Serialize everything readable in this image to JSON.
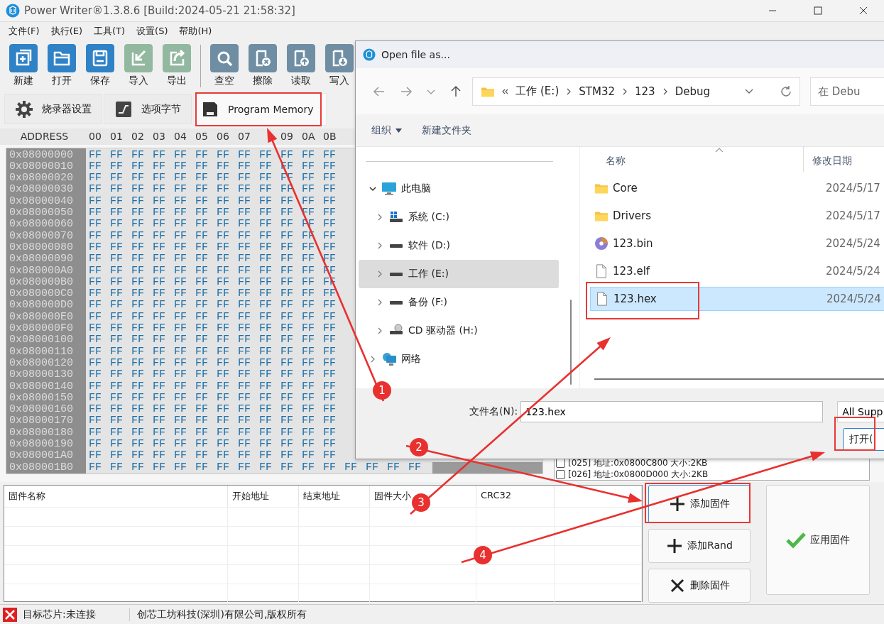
{
  "window": {
    "title": "Power Writer®1.3.8.6 [Build:2024-05-21 21:58:32]"
  },
  "menu": [
    "文件(F)",
    "执行(E)",
    "工具(T)",
    "设置(S)",
    "帮助(H)"
  ],
  "toolbar": {
    "groups": [
      {
        "buttons": [
          "新建",
          "打开",
          "保存",
          "导入",
          "导出"
        ]
      },
      {
        "buttons": [
          "查空",
          "擦除",
          "读取",
          "写入"
        ]
      }
    ]
  },
  "tabs": [
    {
      "label": "烧录器设置",
      "selected": false
    },
    {
      "label": "选项字节",
      "selected": false
    },
    {
      "label": "Program Memory",
      "selected": true
    }
  ],
  "hex_view": {
    "address_header": "ADDRESS",
    "columns": [
      "00",
      "01",
      "02",
      "03",
      "04",
      "05",
      "06",
      "07"
    ],
    "columns_after_arrow": [
      "09",
      "0A",
      "0B"
    ],
    "rows": [
      {
        "address": "0x08000000",
        "bytes": [
          "FF",
          "FF",
          "FF",
          "FF",
          "FF",
          "FF",
          "FF",
          "FF",
          "FF",
          "FF",
          "FF",
          "FF"
        ]
      },
      {
        "address": "0x08000010",
        "bytes": [
          "FF",
          "FF",
          "FF",
          "FF",
          "FF",
          "FF",
          "FF",
          "FF",
          "FF",
          "FF",
          "FF",
          "FF"
        ]
      },
      {
        "address": "0x08000020",
        "bytes": [
          "FF",
          "FF",
          "FF",
          "FF",
          "FF",
          "FF",
          "FF",
          "FF",
          "FF",
          "FF",
          "FF",
          "FF"
        ]
      },
      {
        "address": "0x08000030",
        "bytes": [
          "FF",
          "FF",
          "FF",
          "FF",
          "FF",
          "FF",
          "FF",
          "FF",
          "FF",
          "FF",
          "FF",
          "FF"
        ]
      },
      {
        "address": "0x08000040",
        "bytes": [
          "FF",
          "FF",
          "FF",
          "FF",
          "FF",
          "FF",
          "FF",
          "FF",
          "FF",
          "FF",
          "FF",
          "FF"
        ]
      },
      {
        "address": "0x08000050",
        "bytes": [
          "FF",
          "FF",
          "FF",
          "FF",
          "FF",
          "FF",
          "FF",
          "FF",
          "FF",
          "FF",
          "FF",
          "FF"
        ]
      },
      {
        "address": "0x08000060",
        "bytes": [
          "FF",
          "FF",
          "FF",
          "FF",
          "FF",
          "FF",
          "FF",
          "FF",
          "FF",
          "FF",
          "FF",
          "FF"
        ]
      },
      {
        "address": "0x08000070",
        "bytes": [
          "FF",
          "FF",
          "FF",
          "FF",
          "FF",
          "FF",
          "FF",
          "FF",
          "FF",
          "FF",
          "FF",
          "FF"
        ]
      },
      {
        "address": "0x08000080",
        "bytes": [
          "FF",
          "FF",
          "FF",
          "FF",
          "FF",
          "FF",
          "FF",
          "FF",
          "FF",
          "FF",
          "FF",
          "FF"
        ]
      },
      {
        "address": "0x08000090",
        "bytes": [
          "FF",
          "FF",
          "FF",
          "FF",
          "FF",
          "FF",
          "FF",
          "FF",
          "FF",
          "FF",
          "FF",
          "FF"
        ]
      },
      {
        "address": "0x080000A0",
        "bytes": [
          "FF",
          "FF",
          "FF",
          "FF",
          "FF",
          "FF",
          "FF",
          "FF",
          "FF",
          "FF",
          "FF",
          "FF"
        ]
      },
      {
        "address": "0x080000B0",
        "bytes": [
          "FF",
          "FF",
          "FF",
          "FF",
          "FF",
          "FF",
          "FF",
          "FF",
          "FF",
          "FF",
          "FF",
          "FF"
        ]
      },
      {
        "address": "0x080000C0",
        "bytes": [
          "FF",
          "FF",
          "FF",
          "FF",
          "FF",
          "FF",
          "FF",
          "FF",
          "FF",
          "FF",
          "FF",
          "FF"
        ]
      },
      {
        "address": "0x080000D0",
        "bytes": [
          "FF",
          "FF",
          "FF",
          "FF",
          "FF",
          "FF",
          "FF",
          "FF",
          "FF",
          "FF",
          "FF",
          "FF"
        ]
      },
      {
        "address": "0x080000E0",
        "bytes": [
          "FF",
          "FF",
          "FF",
          "FF",
          "FF",
          "FF",
          "FF",
          "FF",
          "FF",
          "FF",
          "FF",
          "FF"
        ]
      },
      {
        "address": "0x080000F0",
        "bytes": [
          "FF",
          "FF",
          "FF",
          "FF",
          "FF",
          "FF",
          "FF",
          "FF",
          "FF",
          "FF",
          "FF",
          "FF"
        ]
      },
      {
        "address": "0x08000100",
        "bytes": [
          "FF",
          "FF",
          "FF",
          "FF",
          "FF",
          "FF",
          "FF",
          "FF",
          "FF",
          "FF",
          "FF",
          "FF"
        ]
      },
      {
        "address": "0x08000110",
        "bytes": [
          "FF",
          "FF",
          "FF",
          "FF",
          "FF",
          "FF",
          "FF",
          "FF",
          "FF",
          "FF",
          "FF",
          "FF"
        ]
      },
      {
        "address": "0x08000120",
        "bytes": [
          "FF",
          "FF",
          "FF",
          "FF",
          "FF",
          "FF",
          "FF",
          "FF",
          "FF",
          "FF",
          "FF",
          "FF"
        ]
      },
      {
        "address": "0x08000130",
        "bytes": [
          "FF",
          "FF",
          "FF",
          "FF",
          "FF",
          "FF",
          "FF",
          "FF",
          "FF",
          "FF",
          "FF",
          "FF"
        ]
      },
      {
        "address": "0x08000140",
        "bytes": [
          "FF",
          "FF",
          "FF",
          "FF",
          "FF",
          "FF",
          "FF",
          "FF",
          "FF",
          "FF",
          "FF",
          "FF"
        ]
      },
      {
        "address": "0x08000150",
        "bytes": [
          "FF",
          "FF",
          "FF",
          "FF",
          "FF",
          "FF",
          "FF",
          "FF",
          "FF",
          "FF",
          "FF",
          "FF"
        ]
      },
      {
        "address": "0x08000160",
        "bytes": [
          "FF",
          "FF",
          "FF",
          "FF",
          "FF",
          "FF",
          "FF",
          "FF",
          "FF",
          "FF",
          "FF",
          "FF"
        ]
      },
      {
        "address": "0x08000170",
        "bytes": [
          "FF",
          "FF",
          "FF",
          "FF",
          "FF",
          "FF",
          "FF",
          "FF",
          "FF",
          "FF",
          "FF",
          "FF"
        ]
      },
      {
        "address": "0x08000180",
        "bytes": [
          "FF",
          "FF",
          "FF",
          "FF",
          "FF",
          "FF",
          "FF",
          "FF",
          "FF",
          "FF",
          "FF",
          "FF"
        ]
      },
      {
        "address": "0x08000190",
        "bytes": [
          "FF",
          "FF",
          "FF",
          "FF",
          "FF",
          "FF",
          "FF",
          "FF",
          "FF",
          "FF",
          "FF",
          "FF"
        ]
      },
      {
        "address": "0x080001A0",
        "bytes": [
          "FF",
          "FF",
          "FF",
          "FF",
          "FF",
          "FF",
          "FF",
          "FF",
          "FF",
          "FF",
          "FF",
          "FF"
        ]
      },
      {
        "address": "0x080001B0",
        "bytes": [
          "FF",
          "FF",
          "FF",
          "FF",
          "FF",
          "FF",
          "FF",
          "FF",
          "FF",
          "FF",
          "FF",
          "FF",
          "FF",
          "FF",
          "FF",
          "FF"
        ]
      }
    ]
  },
  "sector_list": [
    {
      "label": "[025] 地址:0x0800C800 大小:2KB",
      "checked": false
    },
    {
      "label": "[026] 地址:0x0800D000 大小:2KB",
      "checked": false
    }
  ],
  "firmware_table": {
    "columns": [
      "固件名称",
      "开始地址",
      "结束地址",
      "固件大小",
      "CRC32"
    ]
  },
  "firmware_buttons": [
    {
      "label": "添加固件",
      "kind": "add"
    },
    {
      "label": "添加Rand",
      "kind": "add"
    },
    {
      "label": "删除固件",
      "kind": "delete"
    }
  ],
  "apply_button": {
    "label": "应用固件"
  },
  "status_bar": {
    "connected": false,
    "chip": "目标芯片:未连接",
    "company": "创芯工坊科技(深圳)有限公司,版权所有"
  },
  "dialog": {
    "title": "Open file as...",
    "path": [
      "工作 (E:)",
      "STM32",
      "123",
      "Debug"
    ],
    "search_placeholder": "在 Debu",
    "commands": [
      "组织",
      "新建文件夹"
    ],
    "tree": [
      {
        "label": "此电脑",
        "kind": "computer",
        "expanded": true,
        "selected": false,
        "children": [
          {
            "label": "系统 (C:)",
            "kind": "system",
            "expanded": false,
            "selected": false
          },
          {
            "label": "软件 (D:)",
            "kind": "drive",
            "expanded": false,
            "selected": false
          },
          {
            "label": "工作 (E:)",
            "kind": "drive",
            "expanded": false,
            "selected": true
          },
          {
            "label": "备份 (F:)",
            "kind": "drive",
            "expanded": false,
            "selected": false
          },
          {
            "label": "CD 驱动器 (H:)",
            "kind": "cd",
            "expanded": false,
            "selected": false
          }
        ]
      },
      {
        "label": "网络",
        "kind": "network",
        "expanded": false,
        "selected": false
      }
    ],
    "columns": [
      "名称",
      "修改日期"
    ],
    "files": [
      {
        "name": "Core",
        "kind": "folder",
        "date": "2024/5/17",
        "selected": false
      },
      {
        "name": "Drivers",
        "kind": "folder",
        "date": "2024/5/17",
        "selected": false
      },
      {
        "name": "123.bin",
        "kind": "disc",
        "date": "2024/5/24",
        "selected": false
      },
      {
        "name": "123.elf",
        "kind": "file",
        "date": "2024/5/24",
        "selected": false
      },
      {
        "name": "123.hex",
        "kind": "file",
        "date": "2024/5/24",
        "selected": true
      }
    ],
    "file_name_label": "文件名(N):",
    "file_name": "123.hex",
    "filter": "All Supp",
    "open_button": "打开("
  },
  "annotations": [
    {
      "label": "1"
    },
    {
      "label": "2"
    },
    {
      "label": "3"
    },
    {
      "label": "4"
    }
  ]
}
